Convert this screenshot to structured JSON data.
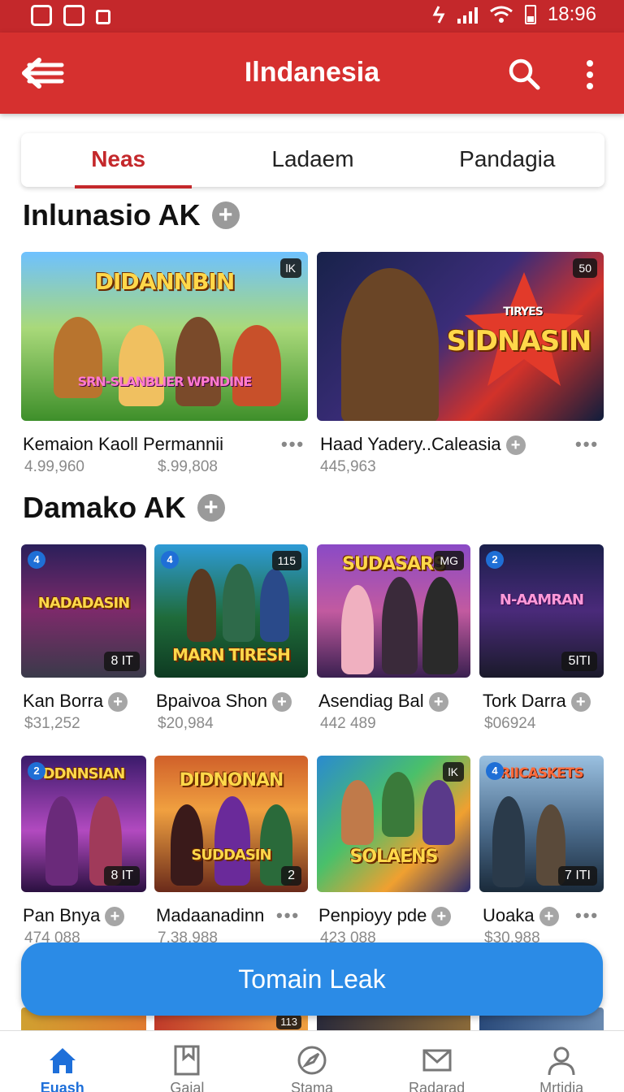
{
  "status_bar": {
    "time": "18:96"
  },
  "app_bar": {
    "title": "Ilndanesia"
  },
  "tabs": [
    {
      "label": "Neas",
      "active": true
    },
    {
      "label": "Ladaem",
      "active": false
    },
    {
      "label": "Pandagia",
      "active": false
    }
  ],
  "section1": {
    "title": "Inlunasio AK",
    "cards": [
      {
        "art_title": "DIDANNBIN",
        "art_subtitle": "SRN-SLANBLIER WPNDINE",
        "badge": "lK",
        "name": "Kemaion Kaoll Permannii",
        "stat1": "4.99,960",
        "stat2": "$.99,808"
      },
      {
        "art_title": "SIDNASIN",
        "art_subtitle": "TIRYES",
        "badge": "50",
        "name": "Haad Yadery..Caleasia",
        "stat1": "445,963"
      }
    ]
  },
  "section2": {
    "title": "Damako AK",
    "cards": [
      {
        "art_title": "NADADASIN",
        "badge_tl": "4",
        "badge_br": "8 IT",
        "name": "Kan Borra",
        "stat": "$31,252"
      },
      {
        "art_title": "MARN TIRESH",
        "badge_tl": "4",
        "badge_tr": "115",
        "name": "Bpaivoa Shon",
        "stat": "$20,984"
      },
      {
        "art_title": "SUDASARS",
        "badge_tr": "MG",
        "name": "Asendiag Bal",
        "stat": "442 489"
      },
      {
        "art_title": "N-AAMRAN",
        "badge_tl": "2",
        "badge_br": "5ITI",
        "name": "Tork Darra",
        "stat": "$06924"
      },
      {
        "art_title": "DDNNSIAN",
        "badge_tl": "2",
        "badge_br": "8 IT",
        "name": "Pan Bnya",
        "stat": "474 088"
      },
      {
        "art_title": "DIDNONAN",
        "art_subtitle": "SUDDASIN",
        "badge_br": "2",
        "name": "Madaanadinn",
        "stat": "7.38,988"
      },
      {
        "art_title": "SOLAENS",
        "badge_tr": "lK",
        "name": "Penpioyy pde",
        "stat": "423 088"
      },
      {
        "art_title": "RIICASKETS",
        "badge_tl": "4",
        "badge_br": "7 ITI",
        "name": "Uoaka",
        "stat": "$30,988"
      }
    ],
    "peek_badge": "113"
  },
  "cta": {
    "label": "Tomain Leak"
  },
  "bottom_nav": [
    {
      "label": "Euash",
      "icon": "home-icon",
      "active": true
    },
    {
      "label": "Gaial",
      "icon": "bookmark-icon",
      "active": false
    },
    {
      "label": "Stama",
      "icon": "compass-icon",
      "active": false
    },
    {
      "label": "Radarad",
      "icon": "mail-icon",
      "active": false
    },
    {
      "label": "Mrtidia",
      "icon": "profile-icon",
      "active": false
    }
  ],
  "colors": {
    "primary": "#d6302f",
    "accent_blue": "#2b8be6",
    "tab_active": "#c4282b"
  }
}
